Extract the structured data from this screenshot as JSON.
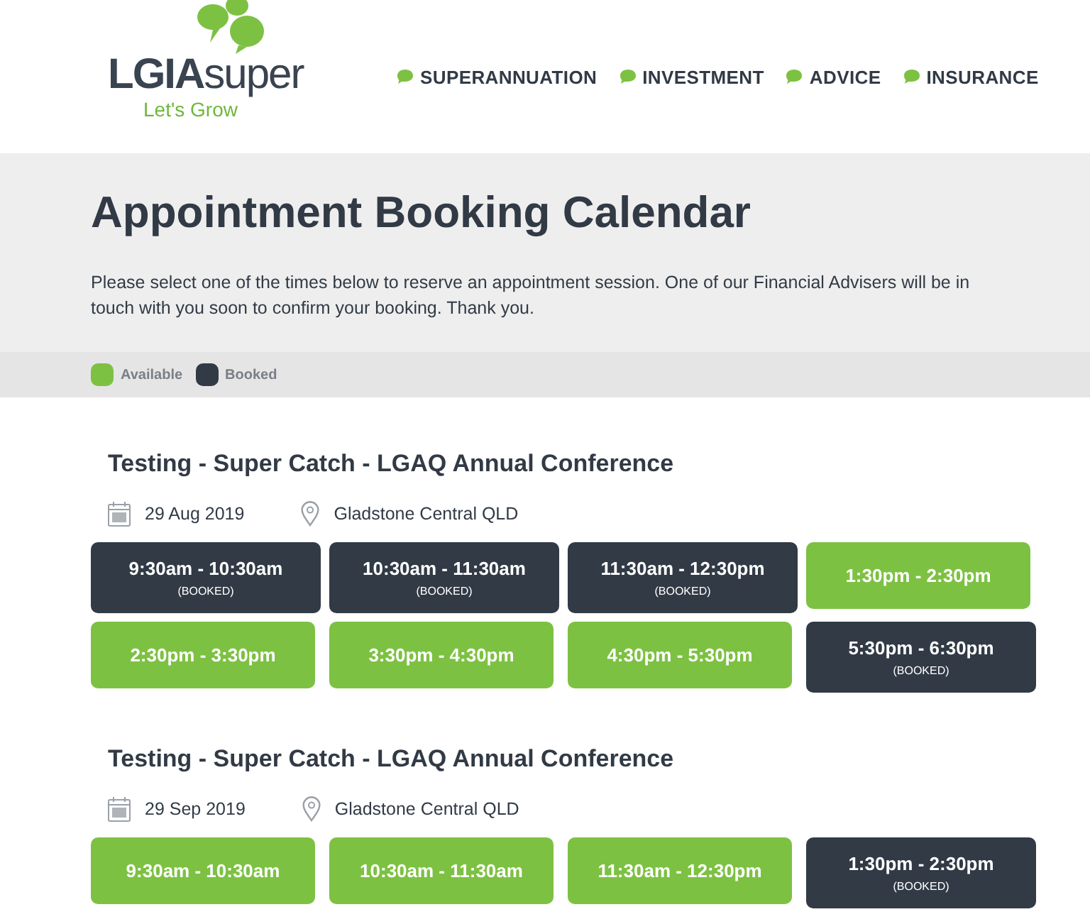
{
  "header": {
    "logo": {
      "name": "**LGIA**super",
      "tagline": "Let's Grow"
    },
    "nav": [
      {
        "label": "SUPERANNUATION"
      },
      {
        "label": "INVESTMENT"
      },
      {
        "label": "ADVICE"
      },
      {
        "label": "INSURANCE"
      }
    ]
  },
  "intro": {
    "title": "Appointment Booking Calendar",
    "text": "Please select one of the times below to reserve an appointment session. One of our Financial Advisers will be in touch with you soon to confirm your booking. Thank you."
  },
  "legend": [
    {
      "label": "Available",
      "color": "#7dc142"
    },
    {
      "label": "Booked",
      "color": "#313a45"
    }
  ],
  "events": [
    {
      "title": "Testing - Super Catch - LGAQ Annual Conference",
      "date": "29 Aug 2019",
      "location": "Gladstone Central QLD",
      "slots": [
        {
          "time": "9:30am - 10:30am",
          "booked": true,
          "note": "(BOOKED)"
        },
        {
          "time": "10:30am - 11:30am",
          "booked": true,
          "note": "(BOOKED)"
        },
        {
          "time": "11:30am - 12:30pm",
          "booked": true,
          "note": "(BOOKED)"
        },
        {
          "time": "1:30pm - 2:30pm",
          "booked": false
        },
        {
          "time": "2:30pm - 3:30pm",
          "booked": false
        },
        {
          "time": "3:30pm - 4:30pm",
          "booked": false
        },
        {
          "time": "4:30pm - 5:30pm",
          "booked": false
        },
        {
          "time": "5:30pm - 6:30pm",
          "booked": true,
          "note": "(BOOKED)"
        }
      ]
    },
    {
      "title": "Testing - Super Catch - LGAQ Annual Conference",
      "date": "29 Sep 2019",
      "location": "Gladstone Central QLD",
      "slots": [
        {
          "time": "9:30am - 10:30am",
          "booked": false
        },
        {
          "time": "10:30am - 11:30am",
          "booked": false
        },
        {
          "time": "11:30am - 12:30pm",
          "booked": false
        },
        {
          "time": "1:30pm - 2:30pm",
          "booked": true,
          "note": "(BOOKED)"
        }
      ]
    }
  ]
}
